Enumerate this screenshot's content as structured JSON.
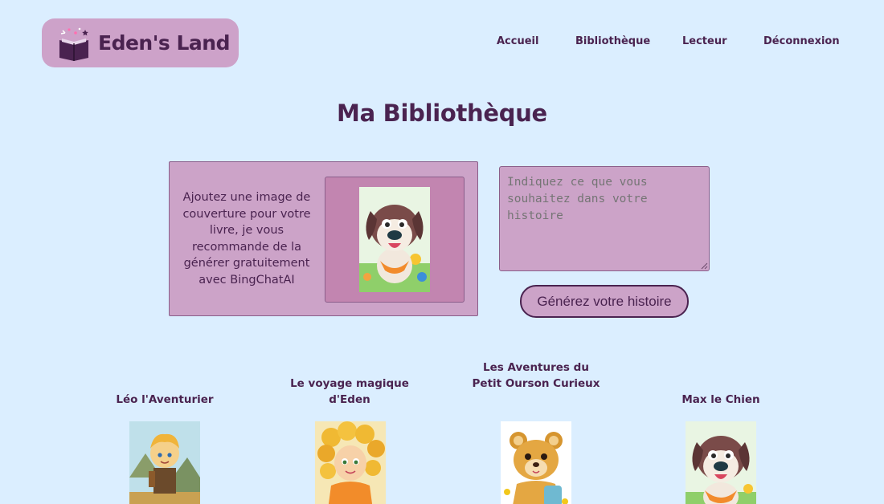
{
  "header": {
    "logo_text": "Eden's Land",
    "nav": [
      "Accueil",
      "Bibliothèque",
      "Lecteur",
      "Déconnexion"
    ]
  },
  "page_title": "Ma Bibliothèque",
  "upload": {
    "instructions": "Ajoutez une image de couverture pour votre livre, je vous recommande de la générer gratuitement avec BingChatAI",
    "cover_image": "dog-cover-image"
  },
  "prompt": {
    "placeholder": "Indiquez ce que vous souhaitez dans votre histoire",
    "value": ""
  },
  "generate_button": "Générez votre histoire",
  "books": [
    {
      "title": "Léo l'Aventurier",
      "cover": "boy-adventurer-image"
    },
    {
      "title": "Le voyage magique d'Eden",
      "cover": "curly-girl-image"
    },
    {
      "title": "Les Aventures du Petit Ourson Curieux",
      "cover": "teddy-bear-image"
    },
    {
      "title": "Max le Chien",
      "cover": "dog-image"
    }
  ],
  "colors": {
    "background": "#dbeeff",
    "accent": "#cca3c8",
    "text": "#4a2350"
  }
}
